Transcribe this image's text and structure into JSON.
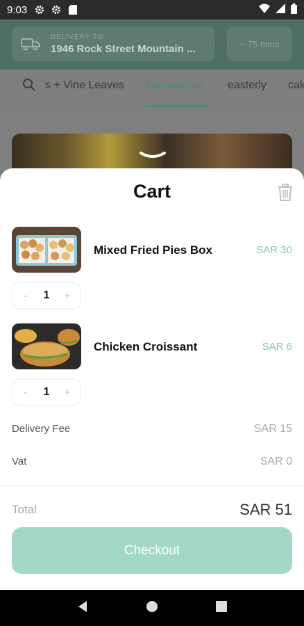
{
  "status_bar": {
    "time": "9:03"
  },
  "header": {
    "delivery_label": "DELIVERY TO",
    "delivery_address": "1946 Rock Street Mountain ...",
    "eta": "~ 75 mins"
  },
  "category_tabs": [
    {
      "label": "s + Vine Leaves",
      "active": false
    },
    {
      "label": "sandwiches",
      "active": true
    },
    {
      "label": "easterly",
      "active": false
    },
    {
      "label": "cak",
      "active": false
    }
  ],
  "cart": {
    "title": "Cart",
    "items": [
      {
        "name": "Mixed Fried Pies Box",
        "price": "SAR 30",
        "quantity": "1",
        "minus": "-",
        "plus": "+"
      },
      {
        "name": "Chicken Croissant",
        "price": "SAR 6",
        "quantity": "1",
        "minus": "-",
        "plus": "+"
      }
    ],
    "delivery_fee_label": "Delivery Fee",
    "delivery_fee_value": "SAR 15",
    "vat_label": "Vat",
    "vat_value": "SAR 0",
    "total_label": "Total",
    "total_value": "SAR 51",
    "checkout_label": "Checkout"
  },
  "colors": {
    "accent": "#7fcbb6",
    "checkout_button": "#a3d8c8"
  }
}
